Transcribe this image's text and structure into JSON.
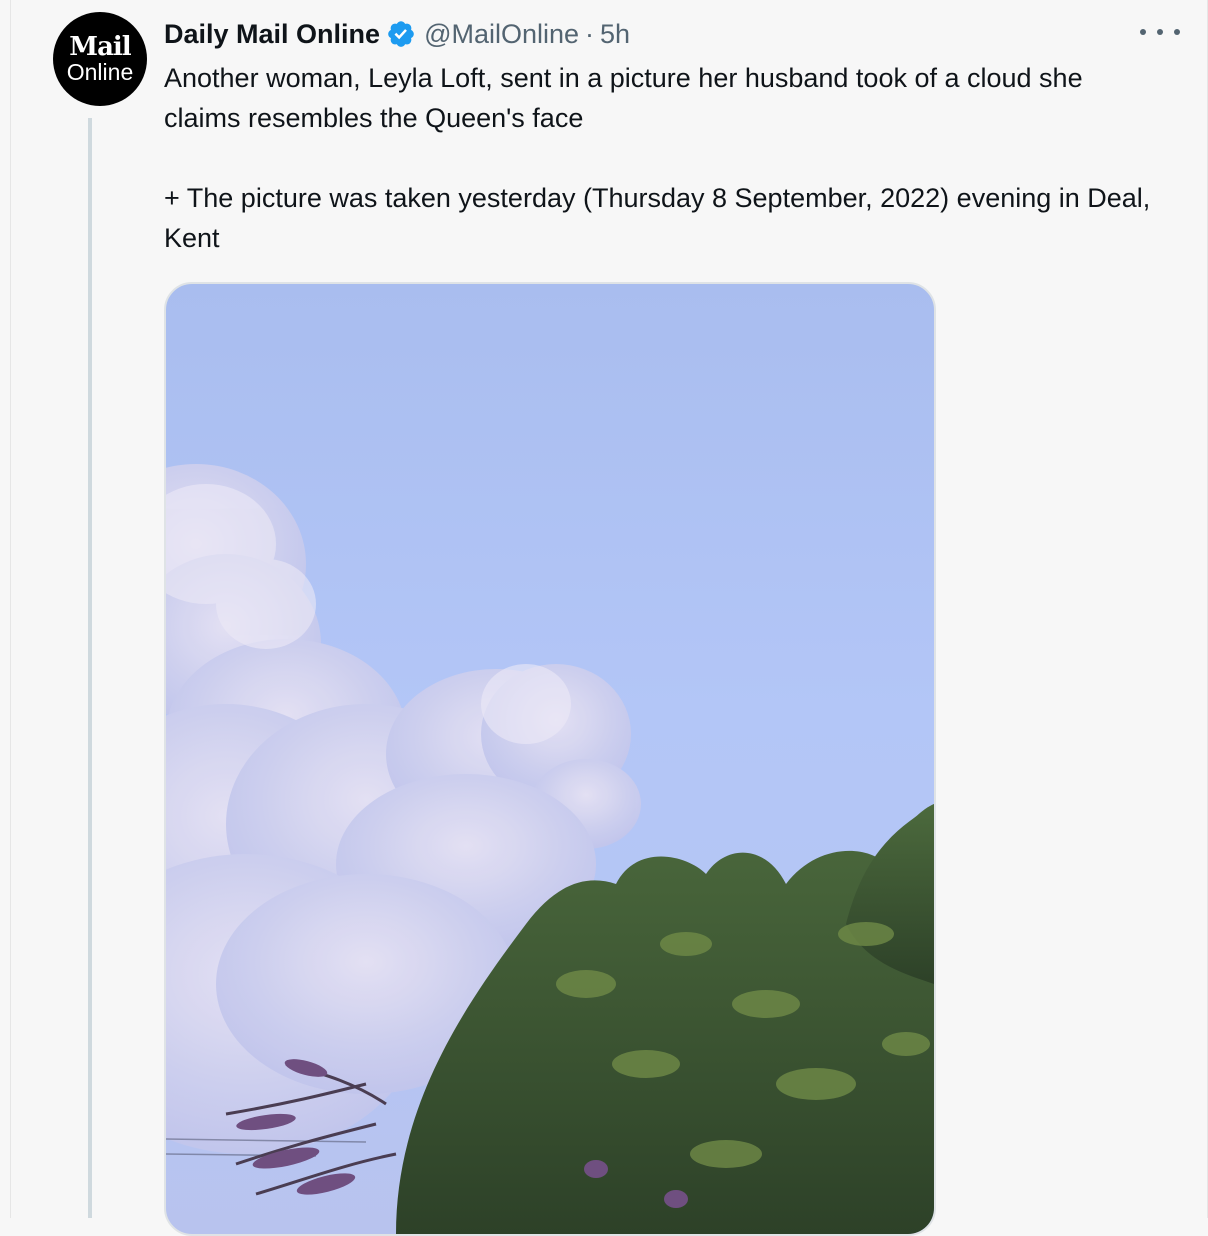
{
  "tweet": {
    "avatar": {
      "line1": "Mail",
      "line2": "Online"
    },
    "author_name": "Daily Mail Online",
    "verified": true,
    "handle": "@MailOnline",
    "separator": "·",
    "time": "5h",
    "more_icon": "more-horizontal-icon",
    "text": "Another woman, Leyla Loft, sent in a picture her husband took of a cloud she claims resembles the Queen's face\n\n+ The picture was taken yesterday (Thursday 8 September, 2022) evening in Deal, Kent",
    "media": {
      "type": "photo"
    }
  },
  "colors": {
    "background": "#f7f7f7",
    "text": "#0f1419",
    "secondary": "#536471",
    "verified": "#1d9bf0",
    "thread_line": "#cfd9de"
  }
}
